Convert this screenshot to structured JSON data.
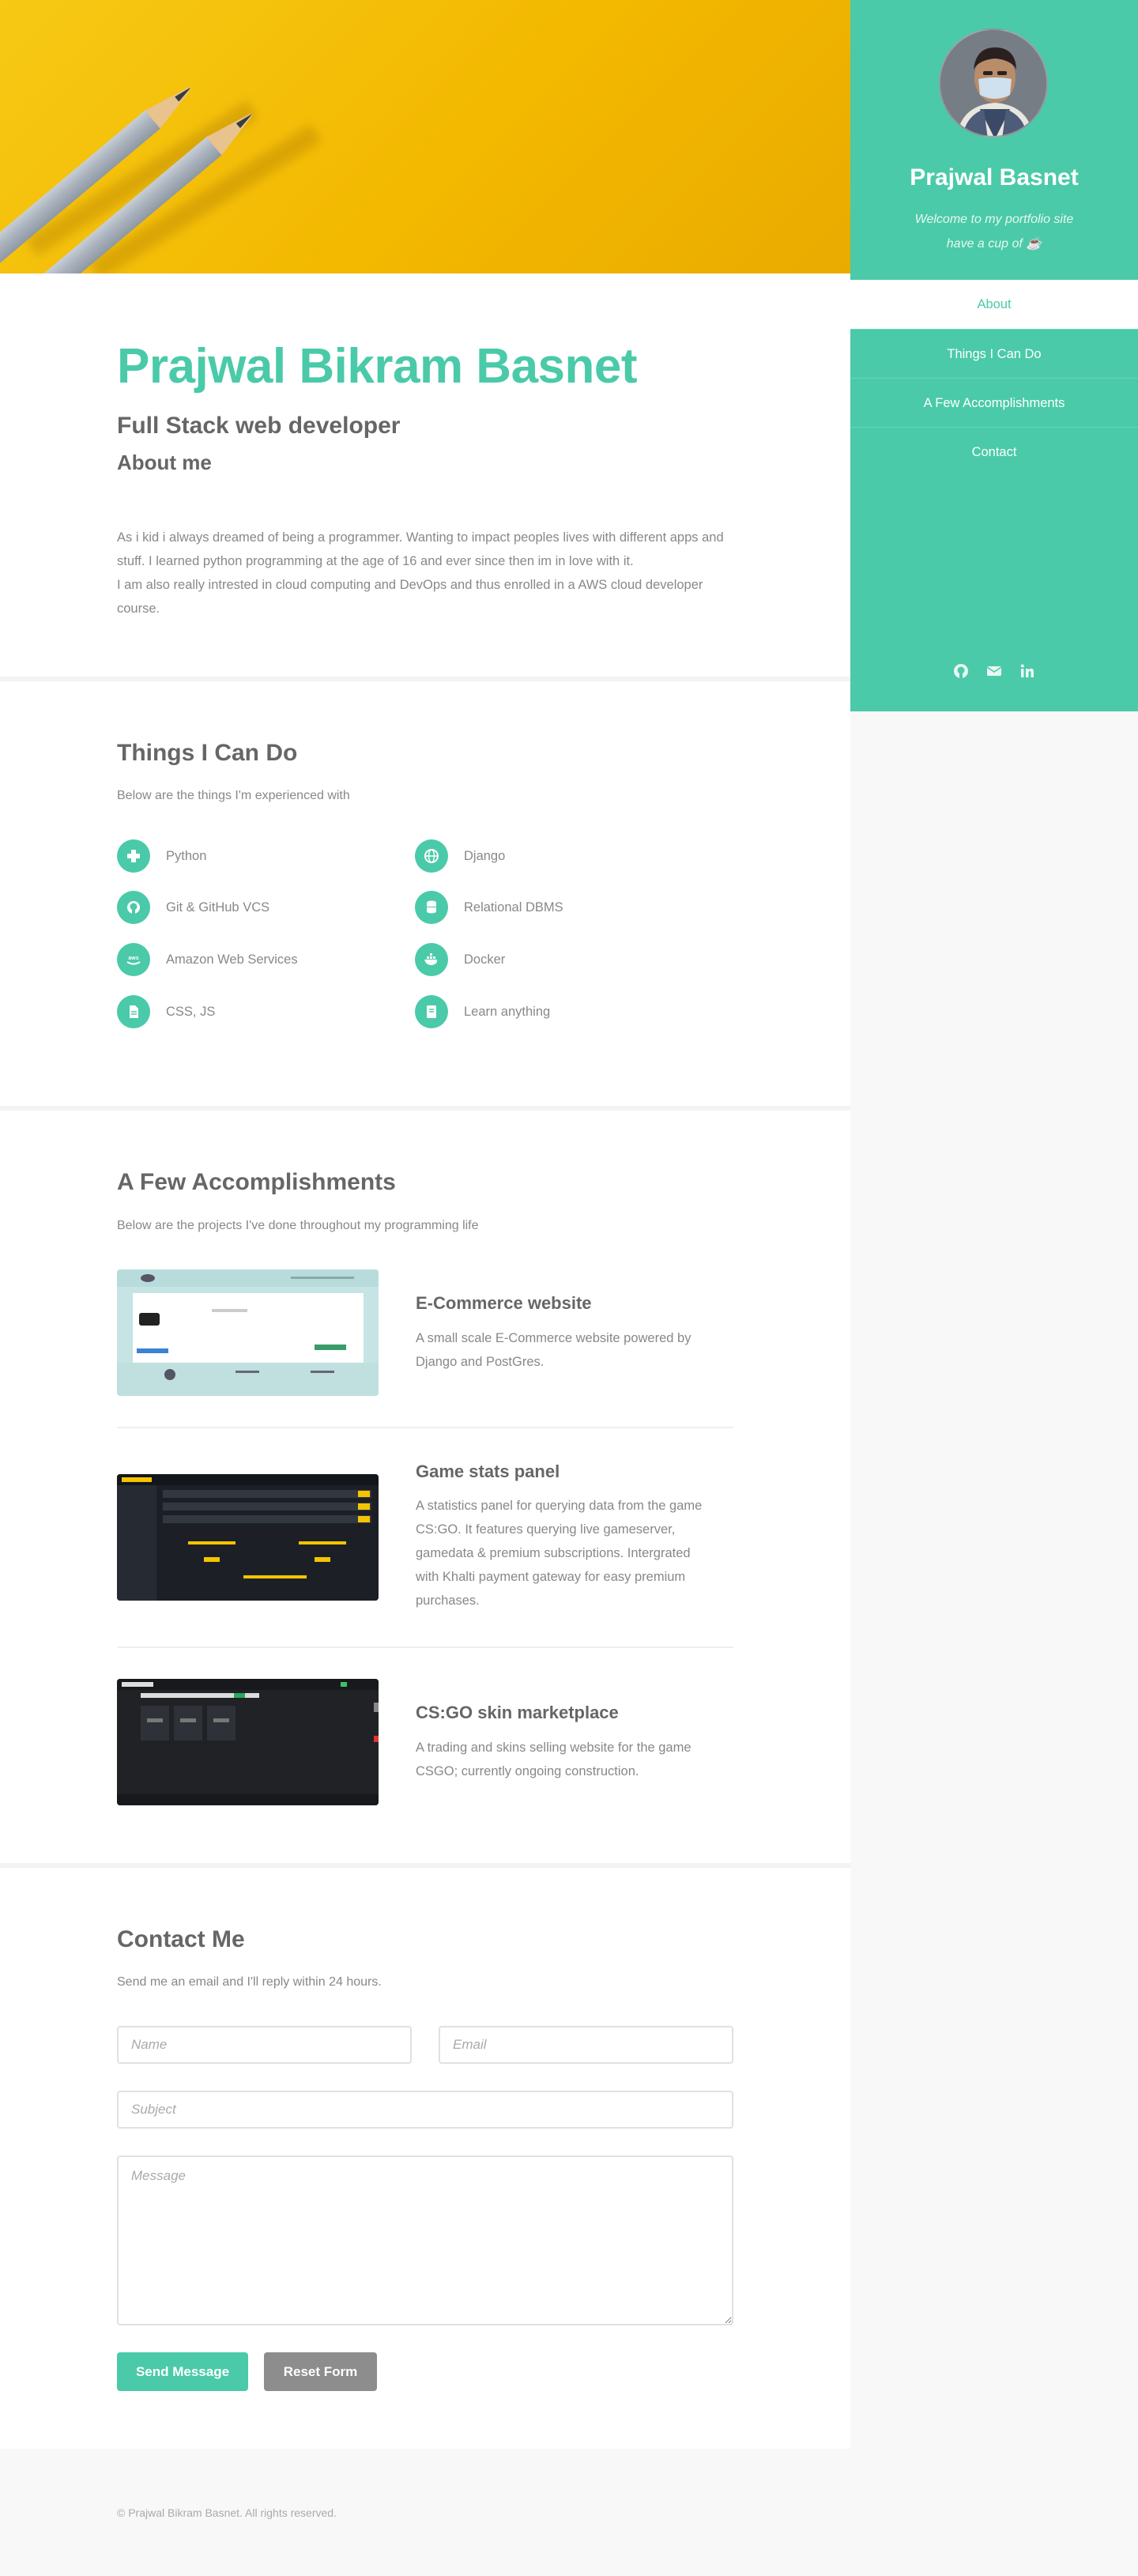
{
  "hero": {
    "name": "Prajwal Bikram Basnet",
    "subtitle": "Full Stack web developer",
    "about_heading": "About me",
    "about_line1": "As i kid i always dreamed of being a programmer. Wanting to impact peoples lives with different apps and stuff. I learned python programming at the age of 16 and ever since then im in love with it.",
    "about_line2": "I am also really intrested in cloud computing and DevOps and thus enrolled in a AWS cloud developer course."
  },
  "skills": {
    "heading": "Things I Can Do",
    "lead": "Below are the things I'm experienced with",
    "items": [
      {
        "label": "Python",
        "icon": "medkit-icon"
      },
      {
        "label": "Django",
        "icon": "globe-icon"
      },
      {
        "label": "Git & GitHub VCS",
        "icon": "github-icon"
      },
      {
        "label": "Relational DBMS",
        "icon": "database-icon"
      },
      {
        "label": "Amazon Web Services",
        "icon": "aws-icon"
      },
      {
        "label": "Docker",
        "icon": "docker-icon"
      },
      {
        "label": "CSS, JS",
        "icon": "file-icon"
      },
      {
        "label": "Learn anything",
        "icon": "book-icon"
      }
    ]
  },
  "projects": {
    "heading": "A Few Accomplishments",
    "lead": "Below are the projects I've done throughout my programming life",
    "items": [
      {
        "title": "E-Commerce website",
        "desc": "A small scale E-Commerce website powered by Django and PostGres."
      },
      {
        "title": "Game stats panel",
        "desc": "A statistics panel for querying data from the game CS:GO. It features querying live gameserver, gamedata & premium subscriptions. Intergrated with Khalti payment gateway for easy premium purchases."
      },
      {
        "title": "CS:GO skin marketplace",
        "desc": "A trading and skins selling website for the game CSGO; currently ongoing construction."
      }
    ]
  },
  "contact": {
    "heading": "Contact Me",
    "lead": "Send me an email and I'll reply within 24 hours.",
    "name_placeholder": "Name",
    "email_placeholder": "Email",
    "subject_placeholder": "Subject",
    "message_placeholder": "Message",
    "send_label": "Send Message",
    "reset_label": "Reset Form"
  },
  "footer": {
    "copyright": "© Prajwal Bikram Basnet. All rights reserved."
  },
  "sidebar": {
    "name": "Prajwal Basnet",
    "tagline1": "Welcome to my portfolio site",
    "tagline2": "have a cup of ☕",
    "nav": [
      "About",
      "Things I Can Do",
      "A Few Accomplishments",
      "Contact"
    ],
    "socials": [
      "github-icon",
      "envelope-icon",
      "linkedin-icon"
    ]
  },
  "colors": {
    "accent": "#4acaa8",
    "banner": "#f3b800",
    "reset_button": "#8d8d8d"
  }
}
